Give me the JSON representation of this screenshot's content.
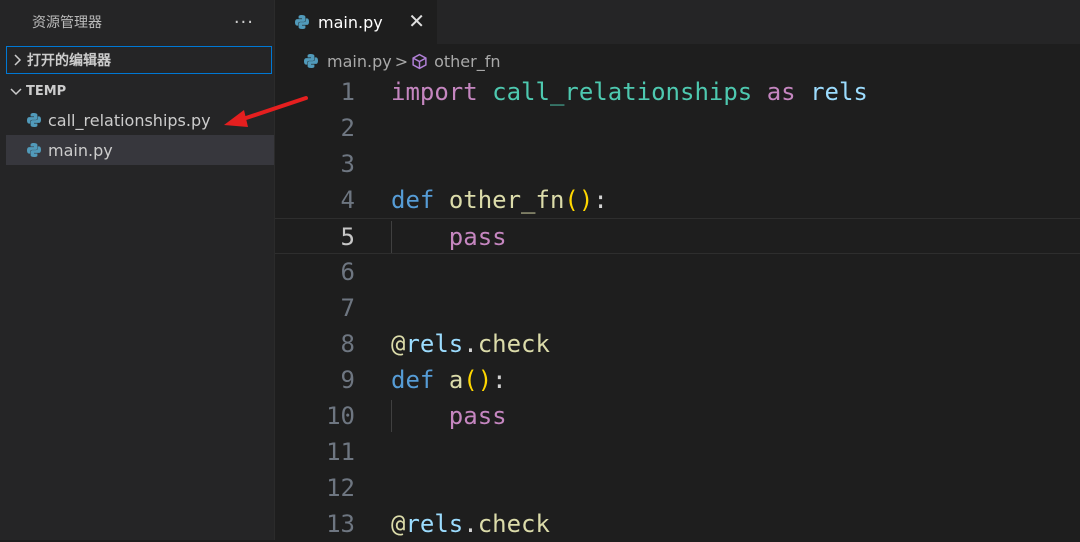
{
  "sidebar": {
    "title": "资源管理器",
    "more": "···",
    "open_editors": "打开的编辑器",
    "folder": "TEMP",
    "files": [
      {
        "label": "call_relationships.py",
        "icon": "python-icon"
      },
      {
        "label": "main.py",
        "icon": "python-icon",
        "selected": true
      }
    ]
  },
  "tab": {
    "label": "main.py",
    "close": "✕"
  },
  "breadcrumb": {
    "file": "main.py",
    "separator": ">",
    "symbol": "other_fn"
  },
  "editor": {
    "current_line": 5,
    "lines": [
      {
        "n": "1",
        "tokens": [
          "import",
          " ",
          "call_relationships",
          " ",
          "as",
          " ",
          "rels"
        ]
      },
      {
        "n": "2",
        "tokens": []
      },
      {
        "n": "3",
        "tokens": []
      },
      {
        "n": "4",
        "tokens": [
          "def",
          " ",
          "other_fn",
          "(",
          ")",
          ":"
        ]
      },
      {
        "n": "5",
        "tokens": [
          "    ",
          "pass"
        ]
      },
      {
        "n": "6",
        "tokens": []
      },
      {
        "n": "7",
        "tokens": []
      },
      {
        "n": "8",
        "tokens": [
          "@",
          "rels",
          ".",
          "check"
        ]
      },
      {
        "n": "9",
        "tokens": [
          "def",
          " ",
          "a",
          "(",
          ")",
          ":"
        ]
      },
      {
        "n": "10",
        "tokens": [
          "    ",
          "pass"
        ]
      },
      {
        "n": "11",
        "tokens": []
      },
      {
        "n": "12",
        "tokens": []
      },
      {
        "n": "13",
        "tokens": [
          "@",
          "rels",
          ".",
          "check"
        ]
      }
    ]
  },
  "annotation": {
    "color": "#e51f1f",
    "points_to": "call_relationships.py"
  }
}
